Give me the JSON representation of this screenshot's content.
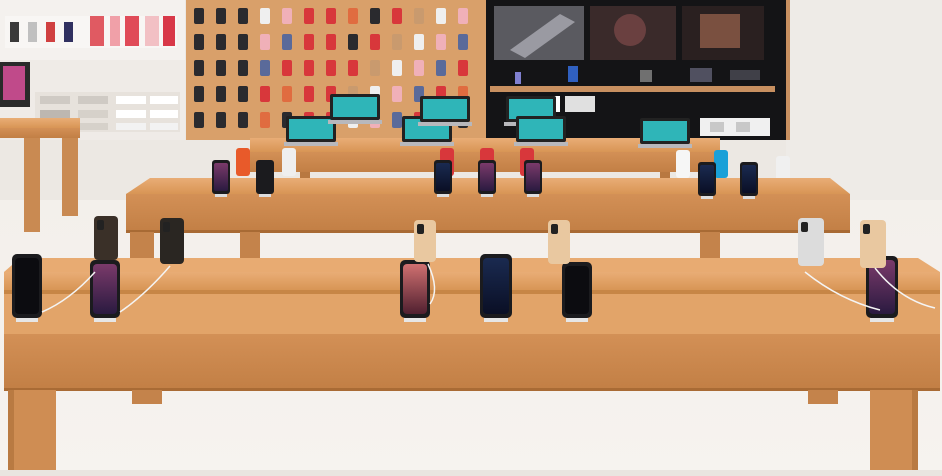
{
  "scene": {
    "kind": "photo",
    "colors": {
      "wall": "#eeeae6",
      "floor": "#f3f0ec",
      "wood_light": "#e3a66f",
      "wood_mid": "#d38f55",
      "wood_dark": "#b87840",
      "display_wall": "#151515",
      "case_red": "#d8373b",
      "case_dark": "#2a2a2e",
      "case_tan": "#c99a6e",
      "case_white": "#efefef",
      "phone_body": "#1b1b1e",
      "gold": "#e9c8a0",
      "silver": "#dcdcdc"
    }
  }
}
